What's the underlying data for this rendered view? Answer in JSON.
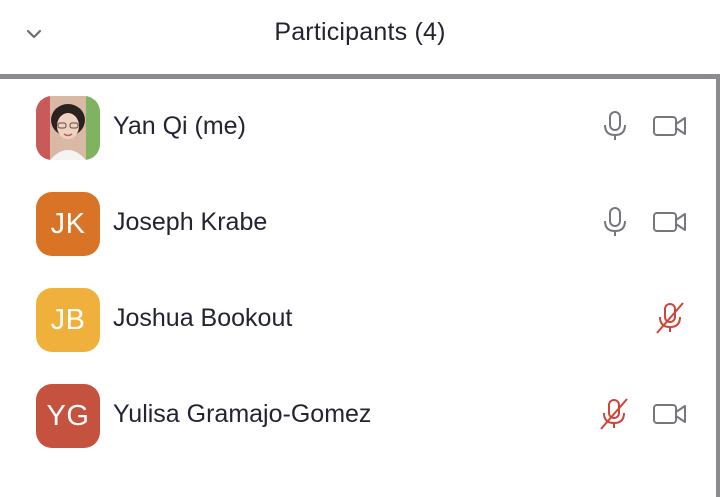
{
  "header": {
    "title": "Participants (4)",
    "collapse_icon": "chevron-down-icon"
  },
  "colors": {
    "mic_muted": "#d0443a",
    "icon_gray": "#76767e",
    "text": "#232333"
  },
  "participants": [
    {
      "name": "Yan Qi (me)",
      "avatar_type": "photo",
      "mic": "on",
      "video": "shown"
    },
    {
      "name": "Joseph Krabe",
      "initials": "JK",
      "avatar_color": "#d97427",
      "mic": "on",
      "video": "shown"
    },
    {
      "name": "Joshua Bookout",
      "initials": "JB",
      "avatar_color": "#f0b13c",
      "mic": "muted",
      "video": "hidden"
    },
    {
      "name": "Yulisa Gramajo-Gomez",
      "initials": "YG",
      "avatar_color": "#c4523e",
      "mic": "muted",
      "video": "shown"
    }
  ]
}
